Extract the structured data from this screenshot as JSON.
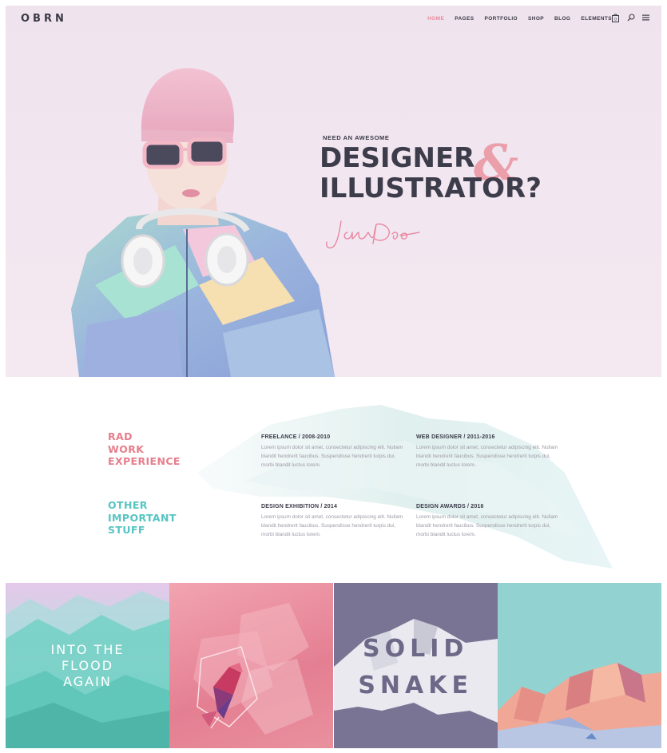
{
  "brand": {
    "logo": "OBRN"
  },
  "nav": {
    "items": [
      "HOME",
      "PAGES",
      "PORTFOLIO",
      "SHOP",
      "BLOG",
      "ELEMENTS"
    ],
    "active_index": 0,
    "cart_count": "0",
    "icons": [
      "cart-icon",
      "search-icon",
      "menu-icon"
    ]
  },
  "hero": {
    "tagline": "NEED AN AWESOME",
    "headline_line1": "DESIGNER",
    "headline_line2": "ILLUSTRATOR?",
    "ampersand": "&",
    "signature": "Jane Doe"
  },
  "experience": {
    "section1_title": [
      "RAD",
      "WORK",
      "EXPERIENCE"
    ],
    "section2_title": [
      "OTHER",
      "IMPORTANT",
      "STUFF"
    ],
    "items": [
      {
        "title": "FREELANCE / 2008-2010",
        "body": "Lorem ipsum dolor sit amet, consectetur adipiscing elit. Nullam blandit hendrerit faucibus. Suspendisse hendrerit turpis dui, morbi blandit luctus lorem."
      },
      {
        "title": "WEB DESIGNER / 2011-2016",
        "body": "Lorem ipsum dolor sit amet, consectetur adipiscing elit. Nullam blandit hendrerit faucibus. Suspendisse hendrerit turpis dui, morbi blandit luctus lorem."
      },
      {
        "title": "DESIGN EXHIBITION / 2014",
        "body": "Lorem ipsum dolor sit amet, consectetur adipiscing elit. Nullam blandit hendrerit faucibus. Suspendisse hendrerit turpis dui, morbi blandit luctus lorem."
      },
      {
        "title": "DESIGN AWARDS / 2016",
        "body": "Lorem ipsum dolor sit amet, consectetur adipiscing elit. Nullam blandit hendrerit faucibus. Suspendisse hendrerit turpis dui, morbi blandit luctus lorem."
      }
    ]
  },
  "portfolio": {
    "tile1_text": [
      "INTO THE",
      "FLOOD",
      "AGAIN"
    ],
    "tile3_text": [
      "SOLID",
      "SNAKE"
    ]
  },
  "colors": {
    "accent_pink": "#e77e8c",
    "accent_teal": "#56c4c3",
    "text_dark": "#3d3c4a",
    "hero_bg": "#f0e4ef"
  }
}
